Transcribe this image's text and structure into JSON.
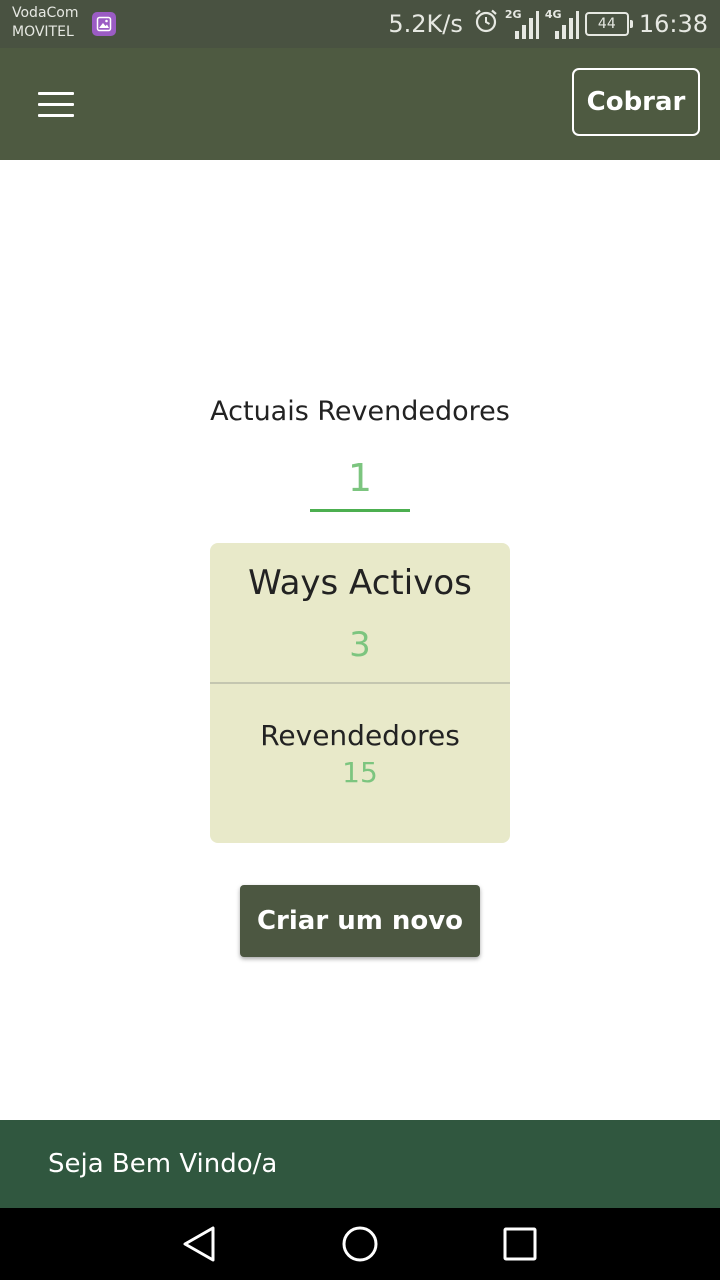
{
  "status_bar": {
    "carrier_1": "VodaCom",
    "carrier_2": "MOVITEL",
    "net_speed": "5.2K/s",
    "signal_1_tag": "2G",
    "signal_2_tag": "4G",
    "battery": "44",
    "time": "16:38"
  },
  "app_bar": {
    "cobrar_label": "Cobrar",
    "menu_icon": "hamburger-menu-icon"
  },
  "main": {
    "section_title": "Actuais Revendedores",
    "current_count": "1",
    "card": {
      "title": "Ways Activos",
      "title_value": "3",
      "subtitle": "Revendedores",
      "subtitle_value": "15"
    },
    "create_label": "Criar um novo"
  },
  "footer": {
    "welcome": "Seja Bem Vindo/a"
  },
  "nav_bar": {
    "back_icon": "back-triangle-icon",
    "home_icon": "home-circle-icon",
    "recents_icon": "recents-square-icon"
  },
  "colors": {
    "app_bar": "#4e5a41",
    "accent_green": "#7cc57f",
    "card_background": "#e8e9c9",
    "footer": "#30573f",
    "button": "#4c5741"
  }
}
